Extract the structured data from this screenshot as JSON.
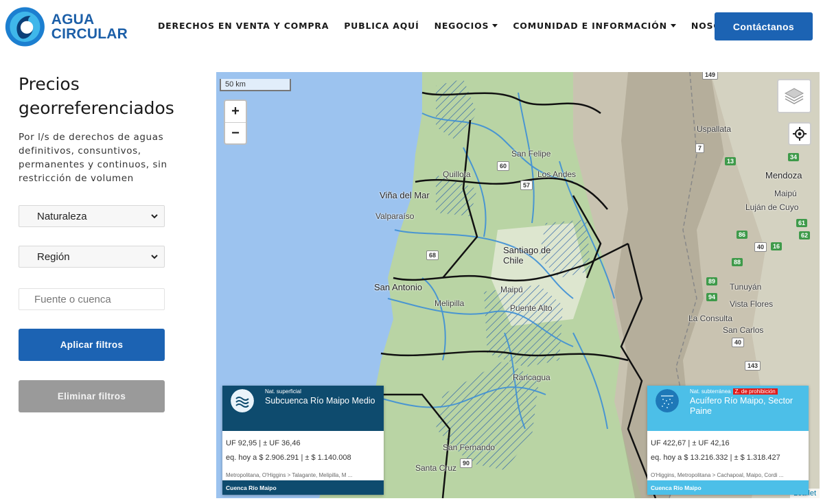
{
  "brand": {
    "line1": "AGUA",
    "line2": "CIRCULAR"
  },
  "nav": {
    "items": [
      {
        "label": "DERECHOS EN VENTA Y COMPRA",
        "dropdown": false
      },
      {
        "label": "PUBLICA AQUÍ",
        "dropdown": false
      },
      {
        "label": "NEGOCIOS",
        "dropdown": true
      },
      {
        "label": "COMUNIDAD E INFORMACIÓN",
        "dropdown": true
      },
      {
        "label": "NOSOTROS",
        "dropdown": true
      }
    ],
    "contact_label": "Contáctanos"
  },
  "sidebar": {
    "title": "Precios georreferenciados",
    "subtitle": "Por l/s de derechos de aguas definitivos, consuntivos, permanentes y continuos, sin restricción de volumen",
    "filters": {
      "naturaleza": "Naturaleza",
      "region": "Región",
      "fuente_placeholder": "Fuente o cuenca"
    },
    "apply_label": "Aplicar filtros",
    "clear_label": "Eliminar filtros"
  },
  "map": {
    "scale_label": "50 km",
    "zoom_in": "+",
    "zoom_out": "−",
    "attribution": "Leaflet",
    "labels": [
      "Viña del Mar",
      "Valparaíso",
      "San Antonio",
      "Melipilla",
      "Santiago de Chile",
      "Maipú",
      "Puente Alto",
      "Los Andes",
      "San Felipe",
      "Quillota",
      "Rancagua",
      "Mendoza",
      "Maipú",
      "Luján de Cuyo",
      "Tunuyán",
      "Vista Flores",
      "La Consulta",
      "San Carlos",
      "Uspallata",
      "Santa Cruz",
      "San Fernando"
    ],
    "shields": [
      "149",
      "7",
      "13",
      "34",
      "60",
      "57",
      "68",
      "86",
      "40",
      "16",
      "61",
      "62",
      "88",
      "89",
      "94",
      "40",
      "143",
      "90"
    ]
  },
  "cards": [
    {
      "type_tag": "Nat. superficial",
      "warning": "",
      "name": "Subcuenca Río Maipo Medio",
      "price_line": "UF 92,95 | ± UF 36,46",
      "today_line": "eq. hoy a $ 2.906.291 | ± $ 1.140.008",
      "location": "Metropolitana, O'Higgins > Talagante, Melipilla, M ...",
      "basin": "Cuenca Río Maipo",
      "color": "#0e4b6e"
    },
    {
      "type_tag": "Nat. subterránea",
      "warning": "Z. de prohibición",
      "name": "Acuífero Río Maipo, Sector Paine",
      "price_line": "UF 422,67 | ± UF 42,16",
      "today_line": "eq. hoy a $ 13.216.332 | ± $ 1.318.427",
      "location": "O'Higgins, Metropolitana > Cachapoal, Maipo, Cordi ...",
      "basin": "Cuenca Río Maipo",
      "color": "#4cbfe8"
    }
  ]
}
